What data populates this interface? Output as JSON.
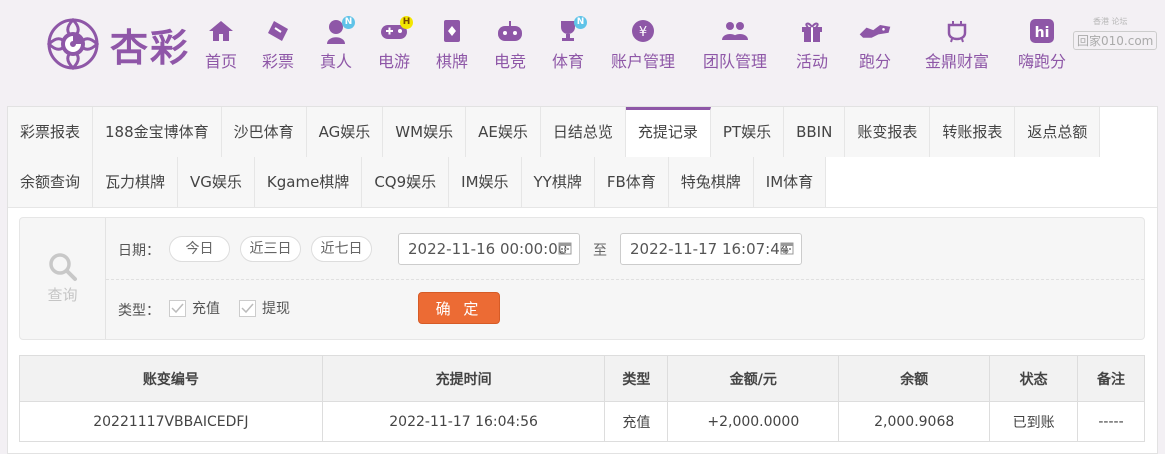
{
  "brand": {
    "name": "杏彩",
    "color": "#8e57a7"
  },
  "nav": [
    {
      "label": "首页",
      "icon": "home-icon"
    },
    {
      "label": "彩票",
      "icon": "lottery-ticket-icon"
    },
    {
      "label": "真人",
      "icon": "live-dealer-icon",
      "badge": "N"
    },
    {
      "label": "电游",
      "icon": "gamepad-icon",
      "badge": "H"
    },
    {
      "label": "棋牌",
      "icon": "cards-icon"
    },
    {
      "label": "电竞",
      "icon": "esports-controller-icon"
    },
    {
      "label": "体育",
      "icon": "trophy-icon",
      "badge": "N"
    },
    {
      "label": "账户管理",
      "icon": "account-coin-icon"
    },
    {
      "label": "团队管理",
      "icon": "team-icon"
    },
    {
      "label": "活动",
      "icon": "gift-icon"
    },
    {
      "label": "跑分",
      "icon": "running-icon"
    },
    {
      "label": "金鼎财富",
      "icon": "ding-vessel-icon"
    },
    {
      "label": "嗨跑分",
      "icon": "hi-app-icon"
    }
  ],
  "watermark": {
    "line1": "香港   论坛",
    "line2": "回家010.com"
  },
  "tabs_row1": [
    "彩票报表",
    "188金宝博体育",
    "沙巴体育",
    "AG娱乐",
    "WM娱乐",
    "AE娱乐",
    "日结总览",
    "充提记录",
    "PT娱乐",
    "BBIN",
    "账变报表",
    "转账报表",
    "返点总额"
  ],
  "tabs_row2": [
    "余额查询",
    "瓦力棋牌",
    "VG娱乐",
    "Kgame棋牌",
    "CQ9娱乐",
    "IM娱乐",
    "YY棋牌",
    "FB体育",
    "特兔棋牌",
    "IM体育"
  ],
  "active_tab": "充提记录",
  "filter": {
    "query_label": "查询",
    "date_label": "日期：",
    "quick_ranges": [
      "今日",
      "近三日",
      "近七日"
    ],
    "start_date": "2022-11-16 00:00:00",
    "to_label": "至",
    "end_date": "2022-11-17 16:07:44",
    "type_label": "类型：",
    "types": [
      {
        "label": "充值",
        "checked": true
      },
      {
        "label": "提现",
        "checked": true
      }
    ],
    "confirm_label": "确 定",
    "confirm_color": "#ec6b34"
  },
  "table": {
    "headers": [
      "账变编号",
      "充提时间",
      "类型",
      "金额/元",
      "余额",
      "状态",
      "备注"
    ],
    "rows": [
      [
        "20221117VBBAICEDFJ",
        "2022-11-17 16:04:56",
        "充值",
        "+2,000.0000",
        "2,000.9068",
        "已到账",
        "-----"
      ]
    ]
  }
}
